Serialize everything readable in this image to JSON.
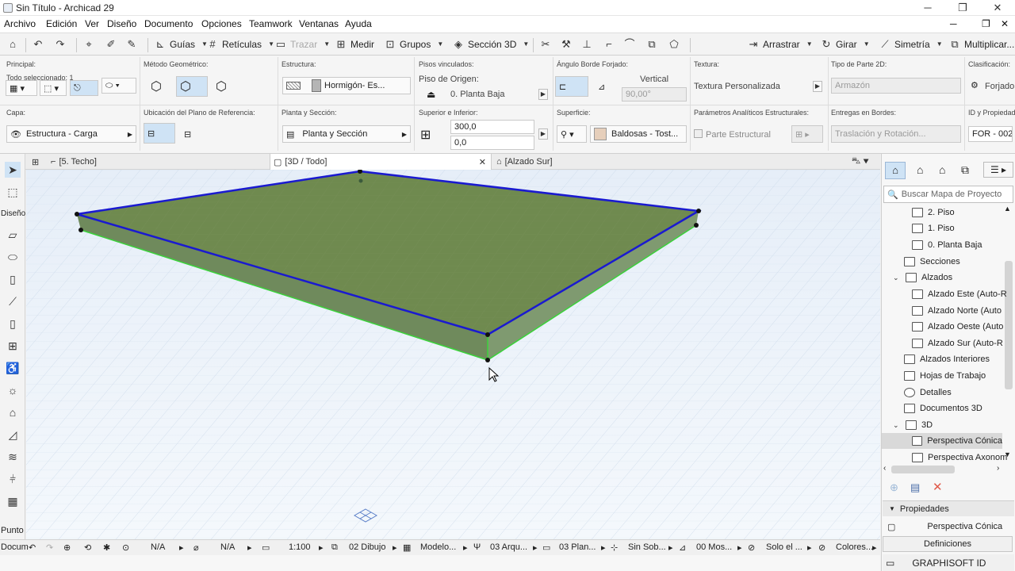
{
  "window": {
    "title": "Sin Título - Archicad 29",
    "minimize": "─",
    "restore": "❐",
    "close": "✕"
  },
  "menu": [
    "Archivo",
    "Edición",
    "Ver",
    "Diseño",
    "Documento",
    "Opciones",
    "Teamwork",
    "Ventanas",
    "Ayuda"
  ],
  "toolbar": {
    "guias": "Guías",
    "reticulas": "Retículas",
    "trazar": "Trazar",
    "medir": "Medir",
    "grupos": "Grupos",
    "seccion3d": "Sección 3D",
    "arrastrar": "Arrastrar",
    "girar": "Girar",
    "simetria": "Simetría",
    "multiplicar": "Multiplicar..."
  },
  "infobox": {
    "principal_label": "Principal:",
    "todo_seleccionado": "Todo seleccionado: 1",
    "metodo_label": "Método Geométrico:",
    "estructura_label": "Estructura:",
    "estructura_value": "Hormigón- Es...",
    "pisos_label": "Pisos vinculados:",
    "piso_origen_label": "Piso de Origen:",
    "piso_origen_value": "0. Planta Baja",
    "angulo_label": "Ángulo Borde Forjado:",
    "vertical": "Vertical",
    "angle_value": "90,00°",
    "textura_label": "Textura:",
    "textura_value": "Textura Personalizada",
    "tipo_parte_label": "Tipo de Parte 2D:",
    "tipo_parte_value": "Armazón",
    "clasif_label": "Clasificación:",
    "clasif_value": "Forjado",
    "capa_label": "Capa:",
    "capa_value": "Estructura - Carga",
    "ubicacion_label": "Ubicación del Plano de Referencia:",
    "planta_label": "Planta y Sección:",
    "planta_value": "Planta y Sección",
    "sup_inf_label": "Superior e Inferior:",
    "sup_value": "300,0",
    "inf_value": "0,0",
    "superficie_label": "Superficie:",
    "superficie_value": "Baldosas - Tost...",
    "analiticos_label": "Parámetros Analíticos Estructurales:",
    "parte_estructural": "Parte Estructural",
    "entregas_label": "Entregas en Bordes:",
    "entregas_value": "Traslación y Rotación...",
    "id_label": "ID y Propiedades:",
    "id_value": "FOR - 002"
  },
  "tabs": {
    "techo": "[5. Techo]",
    "view3d": "[3D / Todo]",
    "alzado": "[Alzado Sur]"
  },
  "leftbar": {
    "diseno": "Diseño",
    "punto": "Punto",
    "docum": "Docum"
  },
  "statusbar": {
    "na1": "N/A",
    "na2": "N/A",
    "scale": "1:100",
    "dibujo": "02 Dibujo",
    "modelo": "Modelo...",
    "arq": "03 Arqu...",
    "plan": "03 Plan...",
    "sinsob": "Sin Sob...",
    "mos": "00 Mos...",
    "solo": "Solo el ...",
    "colores": "Colores..."
  },
  "navigator": {
    "search_placeholder": "Buscar Mapa de Proyecto",
    "items": [
      {
        "label": "2. Piso"
      },
      {
        "label": "1. Piso"
      },
      {
        "label": "0. Planta Baja"
      },
      {
        "label": "Secciones"
      },
      {
        "label": "Alzados"
      },
      {
        "label": "Alzado Este (Auto-R"
      },
      {
        "label": "Alzado Norte (Auto"
      },
      {
        "label": "Alzado Oeste (Auto"
      },
      {
        "label": "Alzado Sur (Auto-R"
      },
      {
        "label": "Alzados Interiores"
      },
      {
        "label": "Hojas de Trabajo"
      },
      {
        "label": "Detalles"
      },
      {
        "label": "Documentos 3D"
      },
      {
        "label": "3D"
      },
      {
        "label": "Perspectiva Cónica"
      },
      {
        "label": "Perspectiva Axonom"
      }
    ],
    "propiedades": "Propiedades",
    "prop_value": "Perspectiva Cónica",
    "definiciones": "Definiciones",
    "graphisoft_id": "GRAPHISOFT ID"
  },
  "colors": {
    "slab_top": "#6f8a4f",
    "slab_edge_blue": "#1a1ad0",
    "slab_edge_green": "#3bd23b",
    "sky": "#e9f1f9"
  }
}
